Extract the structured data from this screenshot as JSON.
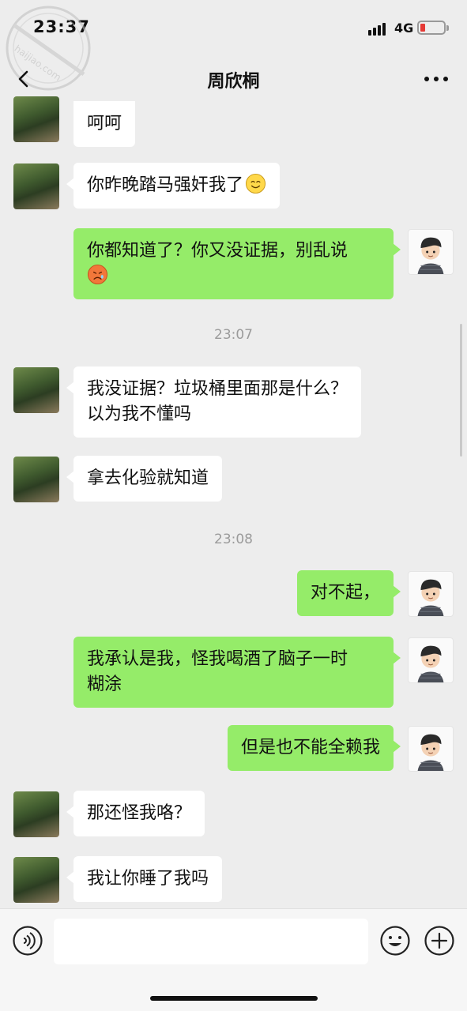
{
  "status_bar": {
    "time": "23:37",
    "network": "4G",
    "battery_color": "#e53935"
  },
  "watermark": {
    "text": "haijiao.com"
  },
  "nav": {
    "title": "周欣桐",
    "back_icon": "chevron-left-icon",
    "more_icon": "more-dots-icon"
  },
  "messages": [
    {
      "side": "left",
      "text": "呵呵"
    },
    {
      "side": "left",
      "text": "你昨晚踏马强奸我了",
      "emoji": "smile-emoji-icon"
    },
    {
      "side": "right",
      "text": "你都知道了？你又没证据，别乱说",
      "emoji": "sad-emoji-icon"
    },
    {
      "side": "left",
      "line1": "我没证据？垃圾桶里面那是什么？",
      "line2": "以为我不懂吗"
    },
    {
      "side": "left",
      "text": "拿去化验就知道"
    },
    {
      "side": "right",
      "text": "对不起，"
    },
    {
      "side": "right",
      "line1": "我承认是我，怪我喝酒了脑子一时",
      "line2": "糊涂"
    },
    {
      "side": "right",
      "text": "但是也不能全赖我"
    },
    {
      "side": "left",
      "text": "那还怪我咯？"
    },
    {
      "side": "left",
      "text": "我让你睡了我吗"
    }
  ],
  "timestamps": [
    "23:07",
    "23:08"
  ],
  "input_bar": {
    "voice_icon": "voice-icon",
    "emoji_icon": "emoji-icon",
    "plus_icon": "plus-icon",
    "input_value": ""
  },
  "colors": {
    "chat_background": "#ededed",
    "sent_bubble": "#95ec69",
    "received_bubble": "#ffffff"
  }
}
